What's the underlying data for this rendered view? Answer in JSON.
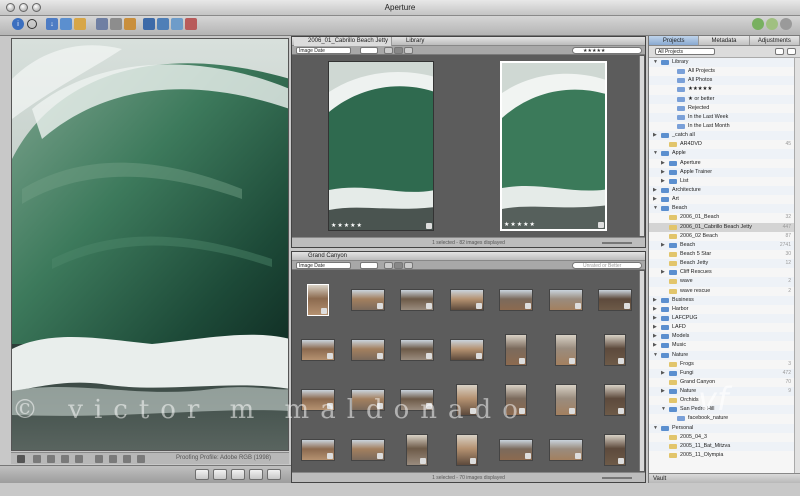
{
  "window": {
    "title": "Aperture"
  },
  "viewer": {
    "proofing": "Proofing Profile: Adobe RGB (1998)"
  },
  "watermark": {
    "text": "© victor m maldonado",
    "logo": "vf"
  },
  "browser_top": {
    "tabs": [
      "2006_01_Cabrillo Beach Jetty",
      "Library"
    ],
    "sort": "Image Date",
    "filter": "★★★★★",
    "thumbs": [
      {
        "stars": "★★★★★"
      },
      {
        "stars": "★★★★★"
      }
    ],
    "status": "1 selected - 82 images displayed"
  },
  "browser_bottom": {
    "tab": "Grand Canyon",
    "sort": "Image Date",
    "search_placeholder": "Unrated or Better",
    "status": "1 selected - 70 images displayed"
  },
  "inspector": {
    "tabs": [
      "Projects",
      "Metadata",
      "Adjustments"
    ],
    "filter": "All Projects",
    "vault": "Vault",
    "items": [
      {
        "label": "Library",
        "indent": 0,
        "arrow": "▼",
        "type": "lib"
      },
      {
        "label": "All Projects",
        "indent": 2,
        "type": "smart"
      },
      {
        "label": "All Photos",
        "indent": 2,
        "type": "smart"
      },
      {
        "label": "★★★★★",
        "indent": 2,
        "type": "smart"
      },
      {
        "label": "★ or better",
        "indent": 2,
        "type": "smart"
      },
      {
        "label": "Rejected",
        "indent": 2,
        "type": "smart"
      },
      {
        "label": "In the Last Week",
        "indent": 2,
        "type": "smart"
      },
      {
        "label": "In the Last Month",
        "indent": 2,
        "type": "smart"
      },
      {
        "label": "_catch all",
        "indent": 0,
        "arrow": "▶",
        "type": "folder"
      },
      {
        "label": "AR4DVD",
        "indent": 1,
        "type": "project",
        "count": "45"
      },
      {
        "label": "Apple",
        "indent": 0,
        "arrow": "▼",
        "type": "folder"
      },
      {
        "label": "Aperture",
        "indent": 1,
        "arrow": "▶",
        "type": "folder"
      },
      {
        "label": "Apple Trainer",
        "indent": 1,
        "arrow": "▶",
        "type": "folder"
      },
      {
        "label": "List",
        "indent": 1,
        "arrow": "▶",
        "type": "folder"
      },
      {
        "label": "Architecture",
        "indent": 0,
        "arrow": "▶",
        "type": "folder"
      },
      {
        "label": "Art",
        "indent": 0,
        "arrow": "▶",
        "type": "folder"
      },
      {
        "label": "Beach",
        "indent": 0,
        "arrow": "▼",
        "type": "folder"
      },
      {
        "label": "2006_01_Beach",
        "indent": 1,
        "type": "project",
        "count": "32"
      },
      {
        "label": "2006_01_Cabrillo Beach Jetty",
        "indent": 1,
        "type": "project",
        "count": "447",
        "selected": true
      },
      {
        "label": "2006_02 Beach",
        "indent": 1,
        "type": "project",
        "count": "87"
      },
      {
        "label": "Beach",
        "indent": 1,
        "arrow": "▶",
        "type": "folder",
        "count": "2741"
      },
      {
        "label": "Beach 5 Star",
        "indent": 1,
        "type": "project",
        "count": "30"
      },
      {
        "label": "Beach Jetty",
        "indent": 1,
        "type": "project",
        "count": "12"
      },
      {
        "label": "Cliff Rescues",
        "indent": 1,
        "arrow": "▶",
        "type": "folder"
      },
      {
        "label": "wave",
        "indent": 1,
        "type": "project",
        "count": "2"
      },
      {
        "label": "wave rescue",
        "indent": 1,
        "type": "project",
        "count": "2"
      },
      {
        "label": "Business",
        "indent": 0,
        "arrow": "▶",
        "type": "folder"
      },
      {
        "label": "Harbor",
        "indent": 0,
        "arrow": "▶",
        "type": "folder"
      },
      {
        "label": "LAFCPUG",
        "indent": 0,
        "arrow": "▶",
        "type": "folder"
      },
      {
        "label": "LAFD",
        "indent": 0,
        "arrow": "▶",
        "type": "folder"
      },
      {
        "label": "Models",
        "indent": 0,
        "arrow": "▶",
        "type": "folder"
      },
      {
        "label": "Music",
        "indent": 0,
        "arrow": "▶",
        "type": "folder"
      },
      {
        "label": "Nature",
        "indent": 0,
        "arrow": "▼",
        "type": "folder"
      },
      {
        "label": "Frogs",
        "indent": 1,
        "type": "project",
        "count": "3"
      },
      {
        "label": "Fungi",
        "indent": 1,
        "arrow": "▶",
        "type": "folder",
        "count": "472"
      },
      {
        "label": "Grand Canyon",
        "indent": 1,
        "type": "project",
        "count": "70"
      },
      {
        "label": "Nature",
        "indent": 1,
        "arrow": "▶",
        "type": "folder",
        "count": "9"
      },
      {
        "label": "Orchids",
        "indent": 1,
        "type": "project"
      },
      {
        "label": "San Pedro Hill",
        "indent": 1,
        "arrow": "▼",
        "type": "folder"
      },
      {
        "label": "facebook_nature",
        "indent": 2,
        "type": "smart"
      },
      {
        "label": "Personal",
        "indent": 0,
        "arrow": "▼",
        "type": "folder"
      },
      {
        "label": "2005_04_3",
        "indent": 1,
        "type": "project"
      },
      {
        "label": "2005_11_Bat_Mitzva",
        "indent": 1,
        "type": "project"
      },
      {
        "label": "2005_11_Olympia",
        "indent": 1,
        "type": "project"
      }
    ]
  },
  "colors": {
    "folder": "#5b8fcf",
    "project": "#e2c56b",
    "smart": "#7aa0d8",
    "selected_row": "#d4d4d4"
  }
}
